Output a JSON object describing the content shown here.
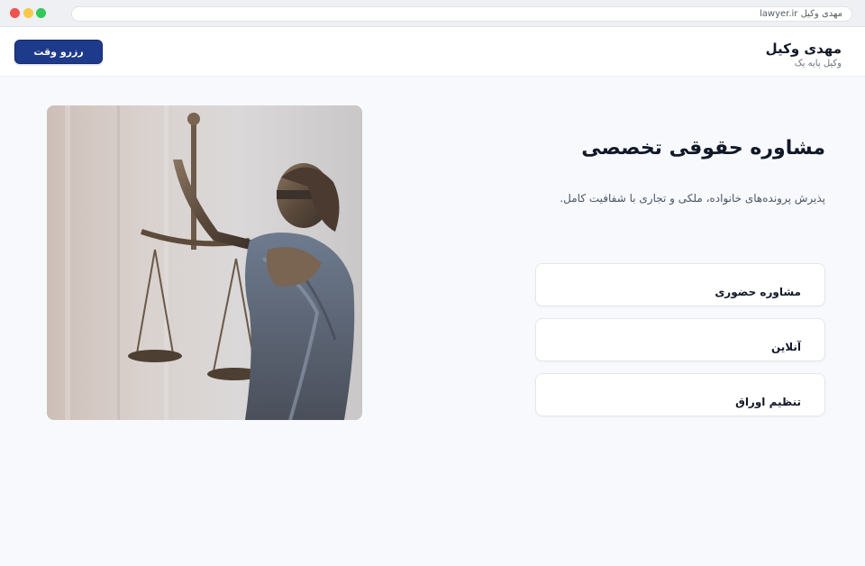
{
  "browser": {
    "url_text": "مهدی وکیل lawyer.ir"
  },
  "header": {
    "brand_name": "مهدی وکیل",
    "brand_subtitle": "وکیل پایه یک",
    "book_button_label": "رزرو وقت"
  },
  "hero": {
    "title": "مشاوره حقوقی تخصصی",
    "description": "پذیرش پرونده‌های خانواده، ملکی و تجاری با شفافیت کامل."
  },
  "services": [
    {
      "label": "مشاوره حضوری"
    },
    {
      "label": "آنلاین"
    },
    {
      "label": "تنظیم اوراق"
    }
  ],
  "colors": {
    "accent": "#1e3a8a",
    "background": "#f7f9fc"
  },
  "icons": {
    "hero_image": "lady-justice-statue-image"
  }
}
